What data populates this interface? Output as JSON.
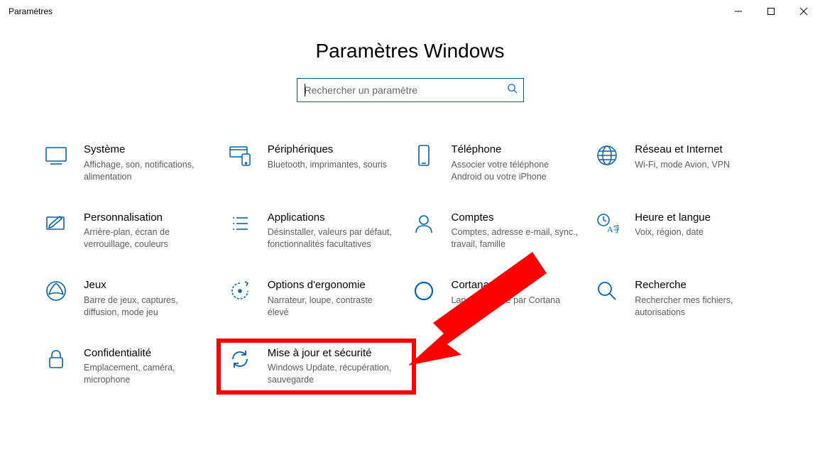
{
  "window": {
    "title": "Paramètres"
  },
  "page": {
    "heading": "Paramètres Windows",
    "search_placeholder": "Rechercher un paramètre"
  },
  "tiles": {
    "system": {
      "title": "Système",
      "desc": "Affichage, son, notifications, alimentation"
    },
    "devices": {
      "title": "Périphériques",
      "desc": "Bluetooth, imprimantes, souris"
    },
    "phone": {
      "title": "Téléphone",
      "desc": "Associer votre téléphone Android ou votre iPhone"
    },
    "network": {
      "title": "Réseau et Internet",
      "desc": "Wi-Fi, mode Avion, VPN"
    },
    "personalization": {
      "title": "Personnalisation",
      "desc": "Arrière-plan, écran de verrouillage, couleurs"
    },
    "apps": {
      "title": "Applications",
      "desc": "Désinstaller, valeurs par défaut, fonctionnalités facultatives"
    },
    "accounts": {
      "title": "Comptes",
      "desc": "Comptes, adresse e-mail, sync., travail, famille"
    },
    "time": {
      "title": "Heure et langue",
      "desc": "Voix, région, date"
    },
    "gaming": {
      "title": "Jeux",
      "desc": "Barre de jeux, captures, diffusion, mode jeu"
    },
    "ease": {
      "title": "Options d'ergonomie",
      "desc": "Narrateur, loupe, contraste élevé"
    },
    "cortana": {
      "title": "Cortana",
      "desc": "Langue utilisée par Cortana"
    },
    "search": {
      "title": "Recherche",
      "desc": "Rechercher mes fichiers, autorisations"
    },
    "privacy": {
      "title": "Confidentialité",
      "desc": "Emplacement, caméra, microphone"
    },
    "update": {
      "title": "Mise à jour et sécurité",
      "desc": "Windows Update, récupération, sauvegarde"
    }
  }
}
